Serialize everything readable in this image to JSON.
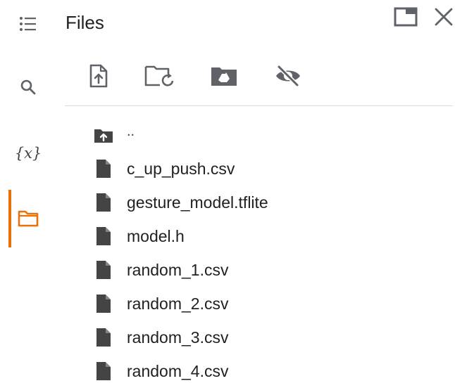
{
  "rail": {
    "items": [
      {
        "id": "toc",
        "icon": "table-of-contents-icon"
      },
      {
        "id": "search",
        "icon": "search-icon"
      },
      {
        "id": "variables",
        "icon": "variables-icon",
        "glyph": "{𝑥}"
      },
      {
        "id": "files",
        "icon": "folder-icon",
        "active": true
      }
    ],
    "active_color": "#e8710a"
  },
  "panel": {
    "title": "Files"
  },
  "toolbar": {
    "buttons": [
      {
        "id": "upload",
        "icon": "upload-file-icon"
      },
      {
        "id": "refresh",
        "icon": "refresh-folder-icon"
      },
      {
        "id": "mount-drive",
        "icon": "google-drive-folder-icon"
      },
      {
        "id": "toggle-hidden",
        "icon": "eye-off-icon"
      }
    ]
  },
  "files": {
    "parent_label": "..",
    "items": [
      {
        "name": "c_up_push.csv"
      },
      {
        "name": "gesture_model.tflite"
      },
      {
        "name": "model.h"
      },
      {
        "name": "random_1.csv"
      },
      {
        "name": "random_2.csv"
      },
      {
        "name": "random_3.csv"
      },
      {
        "name": "random_4.csv"
      }
    ]
  },
  "colors": {
    "icon": "#5f6368",
    "file_icon": "#444444",
    "divider": "#dadce0",
    "accent": "#e8710a"
  }
}
